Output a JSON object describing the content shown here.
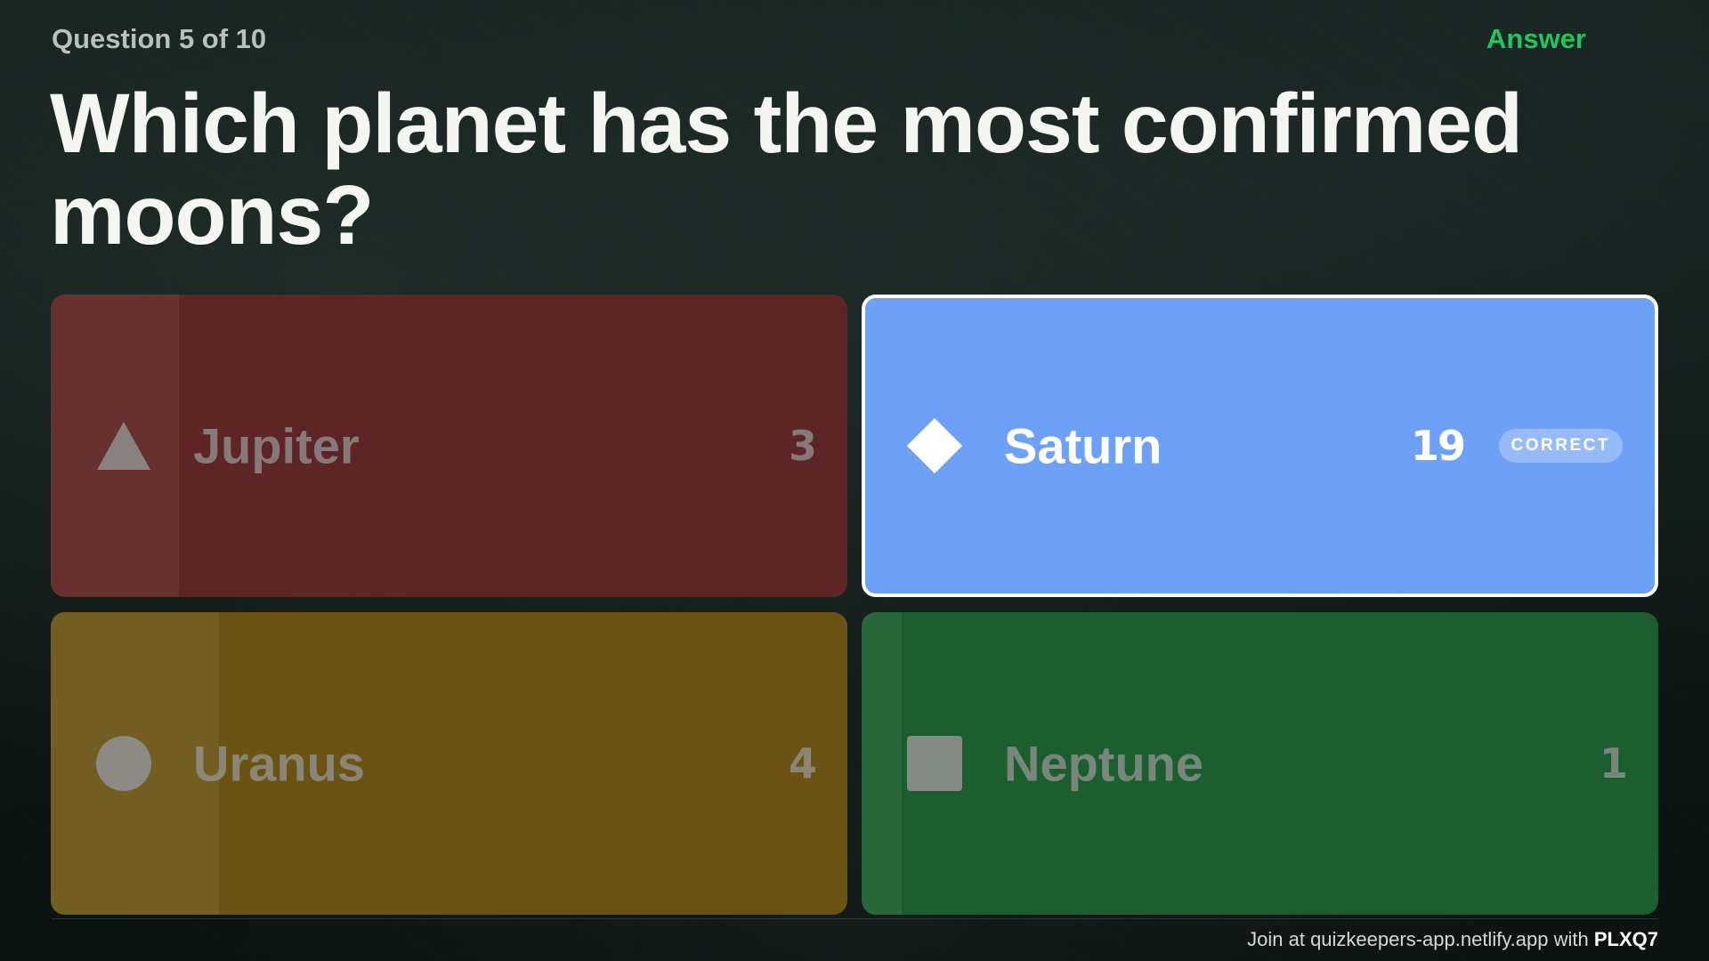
{
  "header": {
    "counter": "Question 5 of 10",
    "phase": "Answer"
  },
  "question": {
    "text": "Which planet has the most confirmed moons?"
  },
  "answers": [
    {
      "label": "Jupiter",
      "count": "3",
      "shape": "triangle-icon",
      "color": "#5e2526",
      "correct": false
    },
    {
      "label": "Saturn",
      "count": "19",
      "shape": "diamond-icon",
      "color": "#6ea1f6",
      "correct": true,
      "badge": "CORRECT"
    },
    {
      "label": "Uranus",
      "count": "4",
      "shape": "circle-icon",
      "color": "#6a5315",
      "correct": false
    },
    {
      "label": "Neptune",
      "count": "1",
      "shape": "square-icon",
      "color": "#1d5e31",
      "correct": false
    }
  ],
  "footer": {
    "join_text": "Join at quizkeepers-app.netlify.app with",
    "code": "PLXQ7"
  },
  "colors": {
    "phase": "#22c55e",
    "background": "#0f1614"
  }
}
